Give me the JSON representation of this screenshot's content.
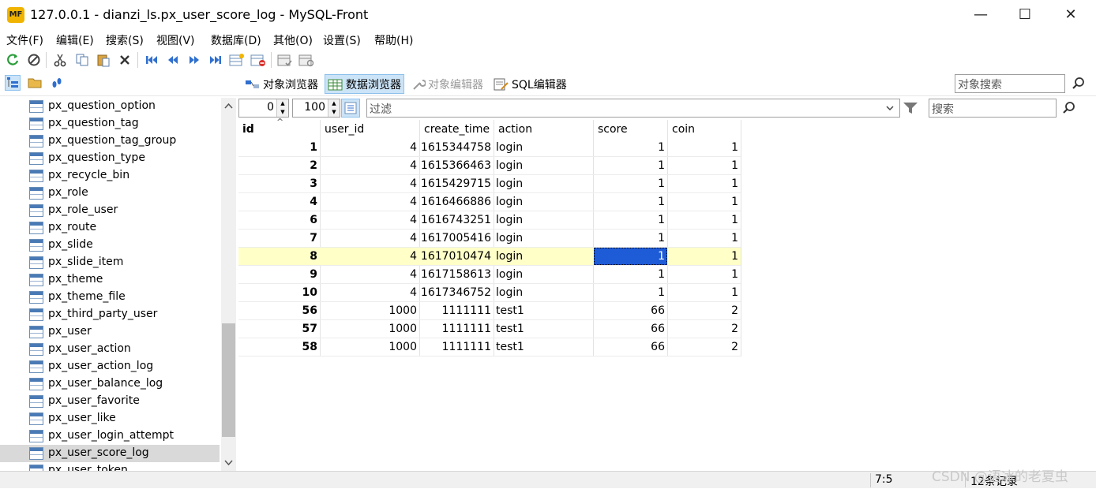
{
  "window": {
    "logo": "MF",
    "title": "127.0.0.1 - dianzi_ls.px_user_score_log - MySQL-Front",
    "minimize": "—",
    "maximize": "☐",
    "close": "✕"
  },
  "menu": {
    "items": [
      "文件(F)",
      "编辑(E)",
      "搜索(S)",
      "视图(V)",
      "数据库(D)",
      "其他(O)",
      "设置(S)",
      "帮助(H)"
    ]
  },
  "toolbar": {
    "icons": [
      "refresh-icon",
      "stop-icon",
      "cut-icon",
      "copy-icon",
      "paste-icon",
      "delete-icon",
      "first-record-icon",
      "prev-record-icon",
      "next-record-icon",
      "last-record-icon",
      "insert-record-icon",
      "delete-record-icon",
      "post-record-icon",
      "cancel-record-icon"
    ]
  },
  "viewbar": {
    "tabs": [
      {
        "label": "对象浏览器",
        "active": false,
        "disabled": false
      },
      {
        "label": "数据浏览器",
        "active": true,
        "disabled": false
      },
      {
        "label": "对象编辑器",
        "active": false,
        "disabled": true
      },
      {
        "label": "SQL编辑器",
        "active": false,
        "disabled": false
      }
    ],
    "object_search_placeholder": "对象搜索"
  },
  "sidebar": {
    "items": [
      "px_question_option",
      "px_question_tag",
      "px_question_tag_group",
      "px_question_type",
      "px_recycle_bin",
      "px_role",
      "px_role_user",
      "px_route",
      "px_slide",
      "px_slide_item",
      "px_theme",
      "px_theme_file",
      "px_third_party_user",
      "px_user",
      "px_user_action",
      "px_user_action_log",
      "px_user_balance_log",
      "px_user_favorite",
      "px_user_like",
      "px_user_login_attempt",
      "px_user_score_log",
      "px_user_token"
    ],
    "selected": "px_user_score_log"
  },
  "filterbar": {
    "offset": "0",
    "limit": "100",
    "filter_placeholder": "过滤",
    "search_placeholder": "搜索"
  },
  "grid": {
    "columns": [
      "id",
      "user_id",
      "create_time",
      "action",
      "score",
      "coin"
    ],
    "rows": [
      [
        "1",
        "4",
        "1615344758",
        "login",
        "1",
        "1"
      ],
      [
        "2",
        "4",
        "1615366463",
        "login",
        "1",
        "1"
      ],
      [
        "3",
        "4",
        "1615429715",
        "login",
        "1",
        "1"
      ],
      [
        "4",
        "4",
        "1616466886",
        "login",
        "1",
        "1"
      ],
      [
        "6",
        "4",
        "1616743251",
        "login",
        "1",
        "1"
      ],
      [
        "7",
        "4",
        "1617005416",
        "login",
        "1",
        "1"
      ],
      [
        "8",
        "4",
        "1617010474",
        "login",
        "1",
        "1"
      ],
      [
        "9",
        "4",
        "1617158613",
        "login",
        "1",
        "1"
      ],
      [
        "10",
        "4",
        "1617346752",
        "login",
        "1",
        "1"
      ],
      [
        "56",
        "1000",
        "1111111",
        "test1",
        "66",
        "2"
      ],
      [
        "57",
        "1000",
        "1111111",
        "test1",
        "66",
        "2"
      ],
      [
        "58",
        "1000",
        "1111111",
        "test1",
        "66",
        "2"
      ]
    ],
    "highlight_row_index": 6,
    "selected_cell": {
      "row": 6,
      "col": 4
    },
    "sort_indicator": "^"
  },
  "status": {
    "position": "7:5",
    "record_count": "12条记录"
  },
  "watermark": "CSDN @语冰的老夏虫",
  "colors": {
    "highlight_row": "#ffffc8",
    "selected_cell": "#1e5bd6",
    "active_tab": "#cce4f7"
  }
}
